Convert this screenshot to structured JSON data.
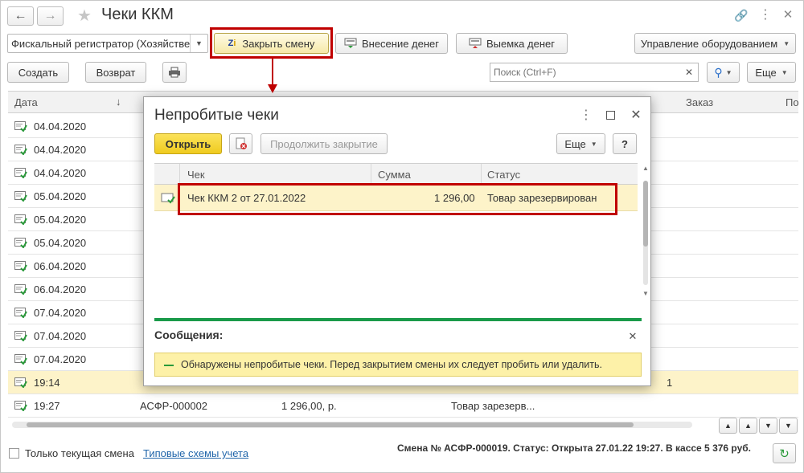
{
  "window": {
    "title": "Чеки ККМ"
  },
  "toolbar": {
    "register_value": "Фискальный регистратор (Хозяйстве",
    "close_shift": "Закрыть смену",
    "deposit": "Внесение денег",
    "withdraw": "Выемка денег",
    "equipment": "Управление оборудованием"
  },
  "actions": {
    "create": "Создать",
    "return": "Возврат",
    "search_placeholder": "Поиск (Ctrl+F)",
    "more": "Еще"
  },
  "table": {
    "columns": [
      "Дата",
      "Заказ",
      "По"
    ],
    "sort_arrow": "↓",
    "rows": [
      {
        "date": "04.04.2020"
      },
      {
        "date": "04.04.2020"
      },
      {
        "date": "04.04.2020"
      },
      {
        "date": "05.04.2020"
      },
      {
        "date": "05.04.2020"
      },
      {
        "date": "05.04.2020"
      },
      {
        "date": "06.04.2020"
      },
      {
        "date": "06.04.2020"
      },
      {
        "date": "07.04.2020"
      },
      {
        "date": "07.04.2020"
      },
      {
        "date": "07.04.2020"
      },
      {
        "date": "19:14",
        "extra": "1"
      },
      {
        "date": "19:27",
        "number": "АСФР-000002",
        "sum": "1 296,00, р.",
        "status": "Товар зарезерв..."
      }
    ]
  },
  "modal": {
    "title": "Непробитые чеки",
    "open": "Открыть",
    "continue": "Продолжить закрытие",
    "more": "Еще",
    "help": "?",
    "columns": {
      "check": "Чек",
      "sum": "Сумма",
      "status": "Статус"
    },
    "row": {
      "check": "Чек ККМ 2 от 27.01.2022",
      "sum": "1 296,00",
      "status": "Товар зарезервирован"
    },
    "messages_title": "Сообщения:",
    "message": "Обнаружены непробитые чеки. Перед закрытием смены их следует пробить или удалить."
  },
  "footer": {
    "only_current": "Только текущая смена",
    "schemes_link": "Типовые схемы учета",
    "status": "Смена № АСФР-000019. Статус: Открыта 27.01.22 19:27. В кассе 5 376 руб."
  },
  "colors": {
    "highlight_frame": "#c00000",
    "selected_row": "#fdf3c9",
    "primary_button": "#f4d63b",
    "message_bg": "#fdf1a8",
    "progress_line": "#1a9a4a",
    "link": "#2266aa"
  }
}
